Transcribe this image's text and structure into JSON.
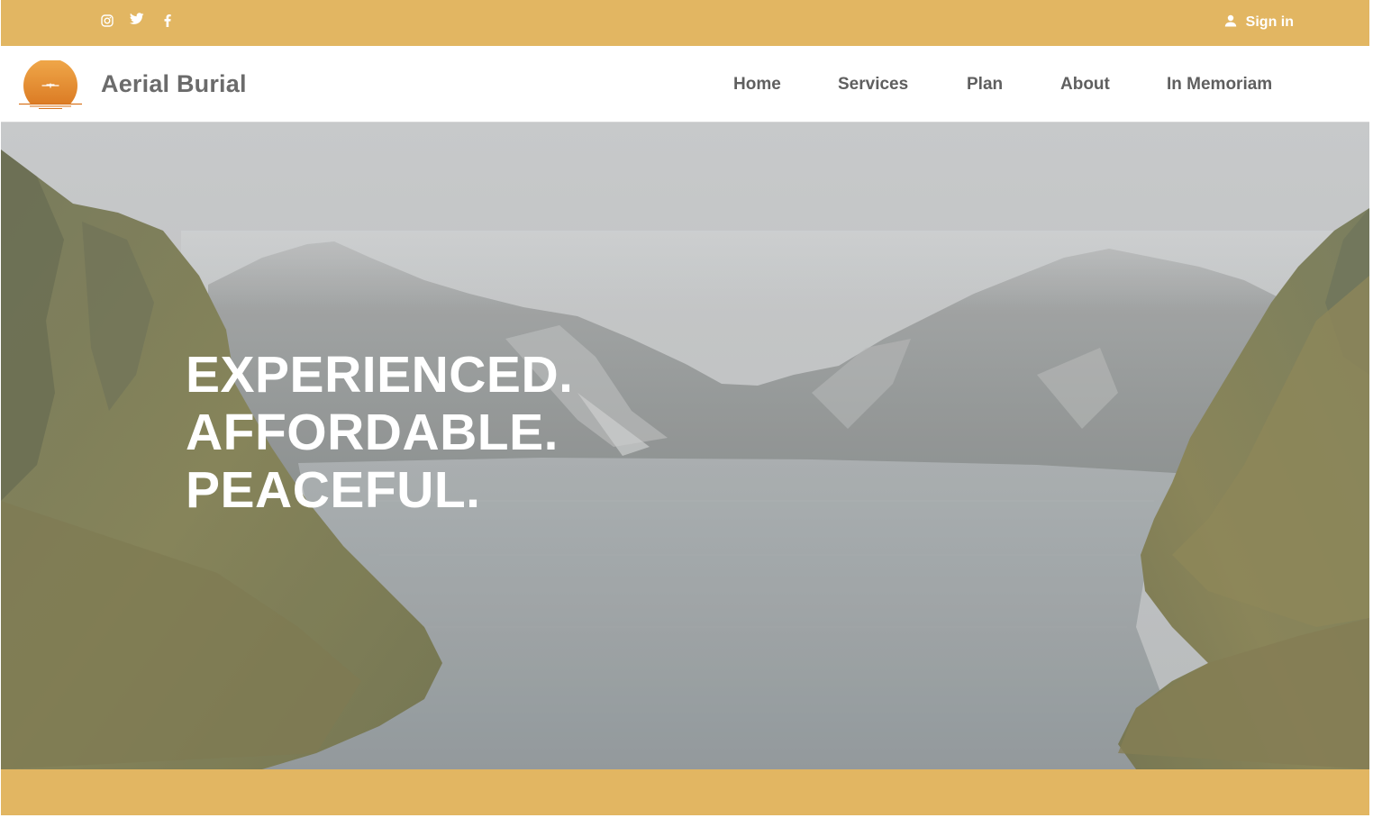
{
  "social": {
    "icons": [
      "instagram-icon",
      "twitter-icon",
      "facebook-icon"
    ]
  },
  "account": {
    "signin_label": "Sign in",
    "icon": "user-icon"
  },
  "brand": {
    "name": "Aerial Burial",
    "logo": "sunset-logo"
  },
  "nav": {
    "items": [
      {
        "label": "Home"
      },
      {
        "label": "Services"
      },
      {
        "label": "Plan"
      },
      {
        "label": "About"
      },
      {
        "label": "In Memoriam"
      }
    ]
  },
  "hero": {
    "lines": [
      "EXPERIENCED.",
      "AFFORDABLE.",
      "PEACEFUL."
    ],
    "background": "mountain-lake-photo"
  },
  "colors": {
    "accent": "#e2b662",
    "nav_text": "#5f5f5f",
    "brand_text": "#6b6b6b",
    "logo_orange": "#e08a2c",
    "hero_text": "#ffffff"
  }
}
